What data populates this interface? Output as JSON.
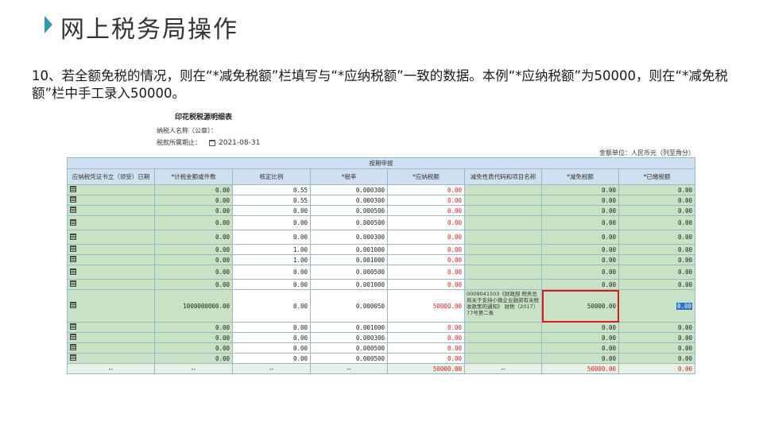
{
  "slide": {
    "title": "网上税务局操作",
    "instruction": "10、若全额免税的情况，则在“*减免税额”栏填写与“*应纳税额”一致的数据。本例“*应纳税额”为50000，则在“*减免税额”栏中手工录入50000。"
  },
  "form": {
    "title": "印花税税源明细表",
    "taxpayer_label": "纳税人名称（公章）：",
    "period_label": "税款所属期止：",
    "period_value": "2021-08-31",
    "unit_note": "金额单位：人民币元（列至角分）",
    "group_header": "按期申报",
    "columns": [
      "应纳税凭证书立（领受）日期",
      "*计税金额或件数",
      "核定比例",
      "*税率",
      "*应纳税额",
      "减免性质代码和项目名称",
      "*减免税额",
      "*已缴税额"
    ],
    "rows": [
      {
        "amount": "0.00",
        "ratio": "0.55",
        "rate": "0.000300",
        "tax": "0.00",
        "code": "",
        "relief": "0.00",
        "paid": "0.00"
      },
      {
        "amount": "0.00",
        "ratio": "0.55",
        "rate": "0.000300",
        "tax": "0.00",
        "code": "",
        "relief": "0.00",
        "paid": "0.00"
      },
      {
        "amount": "0.00",
        "ratio": "0.00",
        "rate": "0.000500",
        "tax": "0.00",
        "code": "",
        "relief": "0.00",
        "paid": "0.00"
      },
      {
        "amount": "0.00",
        "ratio": "0.00",
        "rate": "0.000500",
        "tax": "0.00",
        "code": "",
        "relief": "0.00",
        "paid": "0.00"
      },
      {
        "amount": "0.00",
        "ratio": "0.00",
        "rate": "0.000300",
        "tax": "0.00",
        "code": "",
        "relief": "0.00",
        "paid": "0.00"
      },
      {
        "amount": "0.00",
        "ratio": "1.00",
        "rate": "0.001000",
        "tax": "0.00",
        "code": "",
        "relief": "0.00",
        "paid": "0.00"
      },
      {
        "amount": "0.00",
        "ratio": "1.00",
        "rate": "0.001000",
        "tax": "0.00",
        "code": "",
        "relief": "0.00",
        "paid": "0.00"
      },
      {
        "amount": "0.00",
        "ratio": "0.00",
        "rate": "0.000500",
        "tax": "0.00",
        "code": "",
        "relief": "0.00",
        "paid": "0.00"
      },
      {
        "amount": "0.00",
        "ratio": "0.00",
        "rate": "0.001000",
        "tax": "0.00",
        "code": "",
        "relief": "0.00",
        "paid": "0.00"
      },
      {
        "amount": "1000000000.00",
        "ratio": "0.00",
        "rate": "0.000050",
        "tax": "50000.00",
        "code": "0009041503《财政部 税务总局关于支持小微企业融资有关税收政策的通知》 财税〔2017〕77号第二条",
        "relief": "50000.00",
        "paid": "0.00"
      },
      {
        "amount": "0.00",
        "ratio": "0.00",
        "rate": "0.001000",
        "tax": "0.00",
        "code": "",
        "relief": "0.00",
        "paid": "0.00"
      },
      {
        "amount": "0.00",
        "ratio": "0.00",
        "rate": "0.000300",
        "tax": "0.00",
        "code": "",
        "relief": "0.00",
        "paid": "0.00"
      },
      {
        "amount": "0.00",
        "ratio": "0.00",
        "rate": "0.000500",
        "tax": "0.00",
        "code": "",
        "relief": "0.00",
        "paid": "0.00"
      },
      {
        "amount": "0.00",
        "ratio": "0.00",
        "rate": "0.000500",
        "tax": "0.00",
        "code": "",
        "relief": "0.00",
        "paid": "0.00"
      }
    ],
    "totals": {
      "date": "--",
      "amount": "--",
      "ratio": "--",
      "rate": "--",
      "tax": "50000.00",
      "code": "--",
      "relief": "50000.00",
      "paid": "0.00"
    }
  },
  "colors": {
    "accent": "#2a9db4",
    "editable_cell": "#c8e3c4",
    "header": "#cfe1f0",
    "alert": "#e02020"
  }
}
